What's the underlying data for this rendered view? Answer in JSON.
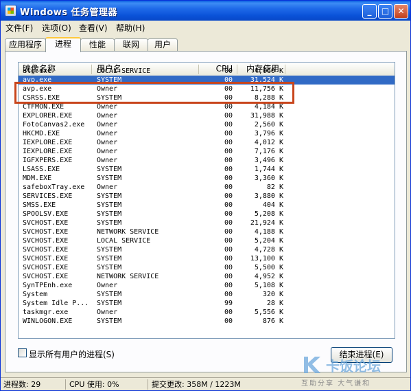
{
  "window": {
    "title": "Windows 任务管理器",
    "minimize": "_",
    "maximize": "□",
    "close": "✕"
  },
  "menu": {
    "items": [
      {
        "label": "文件(F)"
      },
      {
        "label": "选项(O)"
      },
      {
        "label": "查看(V)"
      },
      {
        "label": "帮助(H)"
      }
    ]
  },
  "tabs": [
    {
      "label": "应用程序",
      "active": false
    },
    {
      "label": "进程",
      "active": true
    },
    {
      "label": "性能",
      "active": false
    },
    {
      "label": "联网",
      "active": false
    },
    {
      "label": "用户",
      "active": false
    }
  ],
  "table": {
    "columns": [
      "映像名称",
      "用户名",
      "CPU",
      "内存使用"
    ],
    "rows": [
      {
        "name": "alg.exe",
        "user": "LOCAL SERVICE",
        "cpu": "00",
        "mem": "4,060 K",
        "selected": false
      },
      {
        "name": "avp.exe",
        "user": "SYSTEM",
        "cpu": "00",
        "mem": "31,524 K",
        "selected": true
      },
      {
        "name": "avp.exe",
        "user": "Owner",
        "cpu": "00",
        "mem": "11,756 K",
        "selected": false
      },
      {
        "name": "CSRSS.EXE",
        "user": "SYSTEM",
        "cpu": "00",
        "mem": "8,288 K",
        "selected": false
      },
      {
        "name": "CTFMON.EXE",
        "user": "Owner",
        "cpu": "00",
        "mem": "4,184 K",
        "selected": false
      },
      {
        "name": "EXPLORER.EXE",
        "user": "Owner",
        "cpu": "00",
        "mem": "31,988 K",
        "selected": false
      },
      {
        "name": "FotoCanvas2.exe",
        "user": "Owner",
        "cpu": "00",
        "mem": "2,560 K",
        "selected": false
      },
      {
        "name": "HKCMD.EXE",
        "user": "Owner",
        "cpu": "00",
        "mem": "3,796 K",
        "selected": false
      },
      {
        "name": "IEXPLORE.EXE",
        "user": "Owner",
        "cpu": "00",
        "mem": "4,012 K",
        "selected": false
      },
      {
        "name": "IEXPLORE.EXE",
        "user": "Owner",
        "cpu": "00",
        "mem": "7,176 K",
        "selected": false
      },
      {
        "name": "IGFXPERS.EXE",
        "user": "Owner",
        "cpu": "00",
        "mem": "3,496 K",
        "selected": false
      },
      {
        "name": "LSASS.EXE",
        "user": "SYSTEM",
        "cpu": "00",
        "mem": "1,744 K",
        "selected": false
      },
      {
        "name": "MDM.EXE",
        "user": "SYSTEM",
        "cpu": "00",
        "mem": "3,360 K",
        "selected": false
      },
      {
        "name": "safeboxTray.exe",
        "user": "Owner",
        "cpu": "00",
        "mem": "82 K",
        "selected": false
      },
      {
        "name": "SERVICES.EXE",
        "user": "SYSTEM",
        "cpu": "00",
        "mem": "3,880 K",
        "selected": false
      },
      {
        "name": "SMSS.EXE",
        "user": "SYSTEM",
        "cpu": "00",
        "mem": "404 K",
        "selected": false
      },
      {
        "name": "SPOOLSV.EXE",
        "user": "SYSTEM",
        "cpu": "00",
        "mem": "5,208 K",
        "selected": false
      },
      {
        "name": "SVCHOST.EXE",
        "user": "SYSTEM",
        "cpu": "00",
        "mem": "21,924 K",
        "selected": false
      },
      {
        "name": "SVCHOST.EXE",
        "user": "NETWORK SERVICE",
        "cpu": "00",
        "mem": "4,188 K",
        "selected": false
      },
      {
        "name": "SVCHOST.EXE",
        "user": "LOCAL SERVICE",
        "cpu": "00",
        "mem": "5,204 K",
        "selected": false
      },
      {
        "name": "SVCHOST.EXE",
        "user": "SYSTEM",
        "cpu": "00",
        "mem": "4,728 K",
        "selected": false
      },
      {
        "name": "SVCHOST.EXE",
        "user": "SYSTEM",
        "cpu": "00",
        "mem": "13,100 K",
        "selected": false
      },
      {
        "name": "SVCHOST.EXE",
        "user": "SYSTEM",
        "cpu": "00",
        "mem": "5,500 K",
        "selected": false
      },
      {
        "name": "SVCHOST.EXE",
        "user": "NETWORK SERVICE",
        "cpu": "00",
        "mem": "4,952 K",
        "selected": false
      },
      {
        "name": "SynTPEnh.exe",
        "user": "Owner",
        "cpu": "00",
        "mem": "5,108 K",
        "selected": false
      },
      {
        "name": "System",
        "user": "SYSTEM",
        "cpu": "00",
        "mem": "320 K",
        "selected": false
      },
      {
        "name": "System Idle P...",
        "user": "SYSTEM",
        "cpu": "99",
        "mem": "28 K",
        "selected": false
      },
      {
        "name": "taskmgr.exe",
        "user": "Owner",
        "cpu": "00",
        "mem": "5,556 K",
        "selected": false
      },
      {
        "name": "WINLOGON.EXE",
        "user": "SYSTEM",
        "cpu": "00",
        "mem": "876 K",
        "selected": false
      }
    ]
  },
  "show_all_processes": {
    "label": "显示所有用户的进程(S)",
    "checked": false
  },
  "end_process_button": "结束进程(E)",
  "status": {
    "processes": "进程数: 29",
    "cpu": "CPU 使用: 0%",
    "commit": "提交更改: 358M / 1223M"
  },
  "watermark": {
    "text": "卡饭论坛",
    "sub": "互助分享  大气谦和"
  },
  "colors": {
    "selection": "#316ac5",
    "highlight_box": "#c8451c",
    "titlebar": "#0a52d8"
  }
}
